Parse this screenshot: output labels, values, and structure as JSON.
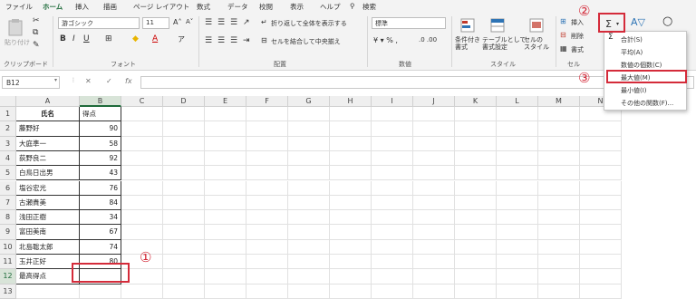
{
  "menu": [
    "ファイル",
    "ホーム",
    "挿入",
    "描画",
    "ページ レイアウト",
    "数式",
    "データ",
    "校閲",
    "表示",
    "ヘルプ",
    "検索"
  ],
  "ribbon": {
    "paste_label": "貼り付け",
    "clipboard_label": "クリップボード",
    "font_name": "游ゴシック",
    "font_size": "11",
    "font_group_label": "フォント",
    "wrap_text": "折り返して全体を表示する",
    "merge_center": "セルを結合して中央揃え",
    "alignment_label": "配置",
    "number_format": "標準",
    "number_label": "数値",
    "conditional_format": "条件付き\n書式",
    "format_as_table": "テーブルとして\n書式設定",
    "cell_styles": "セルの\nスタイル",
    "styles_label": "スタイル",
    "insert_label": "挿入",
    "delete_label": "削除",
    "format_label": "書式",
    "cells_label": "セル",
    "autosum_symbol": "Σ",
    "fx_symbol": "fx"
  },
  "namebox": "B12",
  "autosum_menu": [
    "合計(S)",
    "平均(A)",
    "数値の個数(C)",
    "最大値(M)",
    "最小値(I)",
    "その他の関数(F)..."
  ],
  "columns": [
    "A",
    "B",
    "C",
    "D",
    "E",
    "F",
    "G",
    "H",
    "I",
    "J",
    "K",
    "L",
    "M",
    "N"
  ],
  "rows": [
    "1",
    "2",
    "3",
    "4",
    "5",
    "6",
    "7",
    "8",
    "9",
    "10",
    "11",
    "12",
    "13"
  ],
  "table": {
    "header_name": "氏名",
    "header_score": "得点",
    "names": [
      "藤野好",
      "大庭準一",
      "荻野良二",
      "白鳥日出男",
      "塩谷宏光",
      "古瀬貴美",
      "浅田正樹",
      "富田美南",
      "北島聡太郎",
      "玉井正好",
      "最高得点"
    ],
    "scores": [
      "90",
      "58",
      "92",
      "43",
      "76",
      "84",
      "34",
      "67",
      "74",
      "80",
      ""
    ]
  },
  "callouts": [
    "①",
    "②",
    "③"
  ],
  "colors": {
    "accent_green": "#1e6b3a",
    "callout_red": "#d42b3a"
  }
}
